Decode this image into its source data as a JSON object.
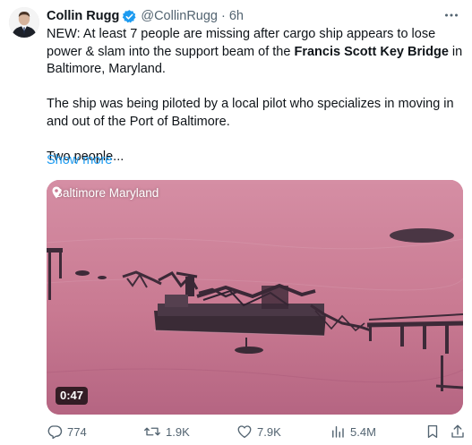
{
  "author": {
    "display_name": "Collin Rugg",
    "handle": "@CollinRugg",
    "time": "6h",
    "verified": true,
    "verified_color": "#1d9bf0"
  },
  "tweet": {
    "line1_prefix": "NEW: At least 7 people are missing after cargo ship appears to lose power & slam into the support beam of the ",
    "line1_bold": "Francis Scott Key Bridge",
    "line1_suffix": " in Baltimore, Maryland.",
    "paragraph2": "The ship was being piloted by a local pilot who specializes in moving in and out of the Port of Baltimore.",
    "paragraph3": "Two people...",
    "show_more": "Show more"
  },
  "media": {
    "location": "Baltimore Maryland",
    "duration": "0:47"
  },
  "actions": {
    "replies": "774",
    "reposts": "1.9K",
    "likes": "7.9K",
    "views": "5.4M"
  },
  "icons": {
    "more": "more-dots-icon",
    "verified": "verified-badge-icon",
    "location": "location-pin-icon",
    "reply": "reply-icon",
    "repost": "repost-icon",
    "like": "heart-icon",
    "views": "views-chart-icon",
    "bookmark": "bookmark-icon",
    "share": "share-icon"
  },
  "colors": {
    "text": "#0f1419",
    "secondary": "#536471",
    "link": "#1d9bf0",
    "media_tint": "#c8728c"
  }
}
